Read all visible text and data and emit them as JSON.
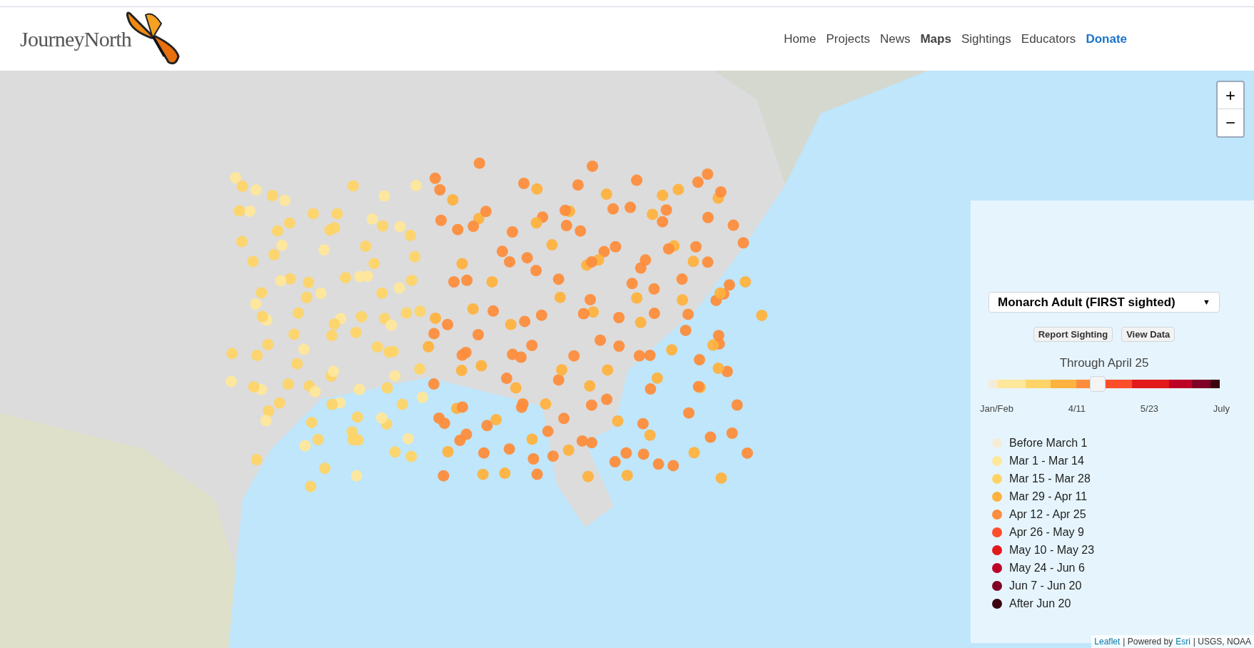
{
  "header": {
    "logo": "JourneyNorth",
    "nav": [
      {
        "label": "Home",
        "selected": false,
        "kind": "link"
      },
      {
        "label": "Projects",
        "selected": false,
        "kind": "link"
      },
      {
        "label": "News",
        "selected": false,
        "kind": "link"
      },
      {
        "label": "Maps",
        "selected": true,
        "kind": "link"
      },
      {
        "label": "Sightings",
        "selected": false,
        "kind": "link"
      },
      {
        "label": "Educators",
        "selected": false,
        "kind": "link"
      },
      {
        "label": "Donate",
        "selected": false,
        "kind": "donate"
      }
    ]
  },
  "map": {
    "zoom_in": "+",
    "zoom_out": "−",
    "attribution": {
      "leaflet": "Leaflet",
      "powered": "| Powered by",
      "esri": "Esri",
      "sources": "| USGS, NOAA"
    }
  },
  "panel": {
    "species": "Monarch Adult (FIRST sighted)",
    "caret": "▼",
    "buttons": [
      "Report Sighting",
      "View Data"
    ],
    "through": "Through April 25",
    "slider": {
      "level": 0.47,
      "ticks": [
        "Jan/Feb",
        "4/11",
        "5/23",
        "July"
      ]
    },
    "legend": [
      {
        "label": "Before March 1",
        "color": "#f4ecd6"
      },
      {
        "label": "Mar 1 - Mar 14",
        "color": "#fee79a"
      },
      {
        "label": "Mar 15 - Mar 28",
        "color": "#fed468"
      },
      {
        "label": "Mar 29 - Apr 11",
        "color": "#feb23f"
      },
      {
        "label": "Apr 12 - Apr 25",
        "color": "#fd8d3c"
      },
      {
        "label": "Apr 26 - May 9",
        "color": "#fc4e2a"
      },
      {
        "label": "May 10 - May 23",
        "color": "#e31a1c"
      },
      {
        "label": "May 24 - Jun 6",
        "color": "#bd0026"
      },
      {
        "label": "Jun 7 - Jun 20",
        "color": "#800026"
      },
      {
        "label": "After Jun 20",
        "color": "#3b0010"
      }
    ]
  }
}
